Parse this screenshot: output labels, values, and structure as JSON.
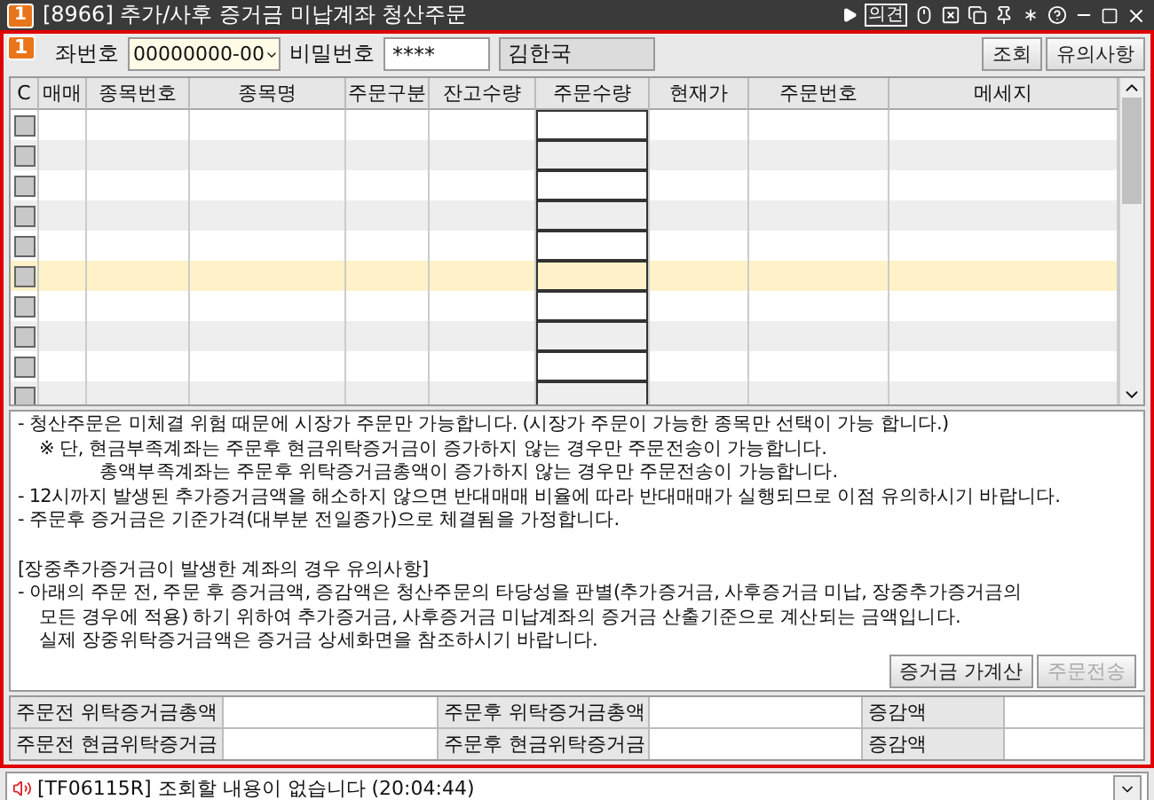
{
  "window": {
    "badge": "1",
    "title": "[8966] 추가/사후 증거금 미납계좌 청산주문",
    "tool_text": "의견"
  },
  "screen_badge": "1",
  "account": {
    "label": "좌번호",
    "value": "00000000-00",
    "password_label": "비밀번호",
    "password": "****",
    "name": "김한국"
  },
  "buttons": [
    {
      "label": "조회",
      "disabled": false
    },
    {
      "label": "유의사항",
      "disabled": false
    }
  ],
  "table": {
    "columns": [
      "C",
      "매매",
      "종목번호",
      "종목명",
      "주문구분",
      "잔고수량",
      "주문수량",
      "현재가",
      "주문번호",
      "메세지"
    ],
    "rows": [
      {
        "selected": false,
        "checked": false
      },
      {
        "selected": false,
        "checked": false
      },
      {
        "selected": false,
        "checked": false
      },
      {
        "selected": false,
        "checked": false
      },
      {
        "selected": false,
        "checked": false
      },
      {
        "selected": true,
        "checked": false
      },
      {
        "selected": false,
        "checked": false
      },
      {
        "selected": false,
        "checked": false
      },
      {
        "selected": false,
        "checked": false
      },
      {
        "selected": false,
        "checked": false
      }
    ]
  },
  "notes": [
    {
      "kind": "line",
      "text": "- 청산주문은 미체결 위험 때문에 시장가 주문만 가능합니다. (시장가 주문이 가능한 종목만 선택이 가능 합니다.)"
    },
    {
      "kind": "indent",
      "text": "※ 단, 현금부족계좌는 주문후 현금위탁증거금이 증가하지 않는 경우만 주문전송이 가능합니다."
    },
    {
      "kind": "deep",
      "text": "총액부족계좌는 주문후 위탁증거금총액이 증가하지 않는 경우만 주문전송이 가능합니다."
    },
    {
      "kind": "line",
      "text": "- 12시까지 발생된 추가증거금액을 해소하지 않으면 반대매매 비율에 따라 반대매매가 실행되므로 이점 유의하시기 바랍니다."
    },
    {
      "kind": "line",
      "text": "- 주문후 증거금은 기준가격(대부분 전일종가)으로 체결됨을 가정합니다."
    },
    {
      "kind": "gap",
      "text": "[장중추가증거금이 발생한 계좌의 경우 유의사항]"
    },
    {
      "kind": "line",
      "text": "- 아래의 주문 전, 주문 후 증거금액, 증감액은 청산주문의 타당성을 판별(추가증거금, 사후증거금 미납, 장중추가증거금의"
    },
    {
      "kind": "indent",
      "text": "모든 경우에 적용) 하기 위하여 추가증거금, 사후증거금 미납계좌의 증거금 산출기준으로 계산되는 금액입니다."
    },
    {
      "kind": "indent",
      "text": "실제 장중위탁증거금액은 증거금 상세화면을 참조하시기 바랍니다."
    }
  ],
  "actions": [
    {
      "label": "증거금 가계산",
      "disabled": false
    },
    {
      "label": "주문전송",
      "disabled": true
    }
  ],
  "summary": [
    [
      "주문전 위탁증거금총액",
      "주문후 위탁증거금총액",
      "증감액"
    ],
    [
      "주문전 현금위탁증거금",
      "주문후 현금위탁증거금",
      "증감액"
    ]
  ],
  "status_bar": {
    "message": "[TF06115R] 조회할 내용이 없습니다 (20:04:44)"
  }
}
